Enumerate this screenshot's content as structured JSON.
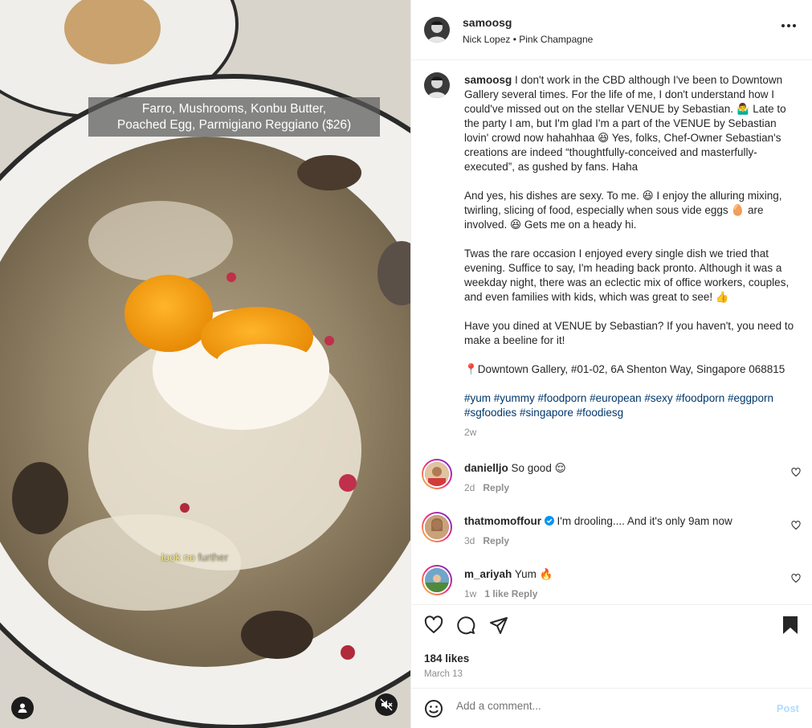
{
  "media": {
    "overlay_caption_line1": "Farro, Mushrooms, Konbu Butter,",
    "overlay_caption_line2": "Poached Egg, Parmigiano Reggiano ($26)",
    "overlay_text_bright": "look no ",
    "overlay_text_faint": "further",
    "user_icon": "user-tag-icon",
    "mute_icon": "sound-off-icon"
  },
  "header": {
    "username": "samoosg",
    "subtitle": "Nick Lopez • Pink Champagne",
    "more_icon": "more-options-icon"
  },
  "caption": {
    "username": "samoosg",
    "text": " I don't work in the CBD although I've been to Downtown Gallery several times. For the life of me, I don't understand how I could've missed out on the stellar VENUE by Sebastian. 🤷‍♂️ Late to the party I am, but I'm glad I'm a part of the VENUE by Sebastian lovin' crowd now hahahhaa 😆 Yes, folks, Chef-Owner Sebastian's creations are indeed “thoughtfully-conceived and masterfully-executed”, as gushed by fans. Haha\n\nAnd yes, his dishes are sexy. To me. 😆 I enjoy the alluring mixing, twirling, slicing of food, especially when sous vide eggs 🥚 are involved. 😆 Gets me on a heady hi.\n\nTwas the rare occasion I enjoyed every single dish we tried that evening. Suffice to say, I'm heading back pronto. Although it was a weekday night, there was an eclectic mix of office workers, couples, and even families with kids, which was great to see! 👍\n\nHave you dined at VENUE by Sebastian? If you haven't, you need to make a beeline for it!\n\n📍Downtown Gallery, #01-02, 6A Shenton Way, Singapore 068815\n\n",
    "hashtags": "#yum #yummy #foodporn #european #sexy #foodporn #eggporn #sgfoodies #singapore #foodiesg",
    "time": "2w"
  },
  "comments": [
    {
      "username": "danielljo",
      "text": "So good 😌",
      "time": "2d",
      "reply": "Reply",
      "verified": false
    },
    {
      "username": "thatmomoffour",
      "text": "I'm drooling.... And it's only 9am now",
      "time": "3d",
      "reply": "Reply",
      "verified": true
    },
    {
      "username": "m_ariyah",
      "text": "Yum 🔥",
      "time": "1w",
      "reply": "1 like  Reply",
      "verified": false
    }
  ],
  "actions": {
    "like_icon": "heart-icon",
    "comment_icon": "comment-icon",
    "share_icon": "share-icon",
    "save_icon": "bookmark-icon",
    "likes": "184 likes",
    "date": "March 13"
  },
  "add_comment": {
    "placeholder": "Add a comment...",
    "post_label": "Post",
    "emoji_icon": "emoji-icon"
  },
  "colors": {
    "link": "#00376b",
    "muted": "#8e8e8e",
    "post_disabled": "#b3dbff",
    "verified": "#0095f6"
  }
}
